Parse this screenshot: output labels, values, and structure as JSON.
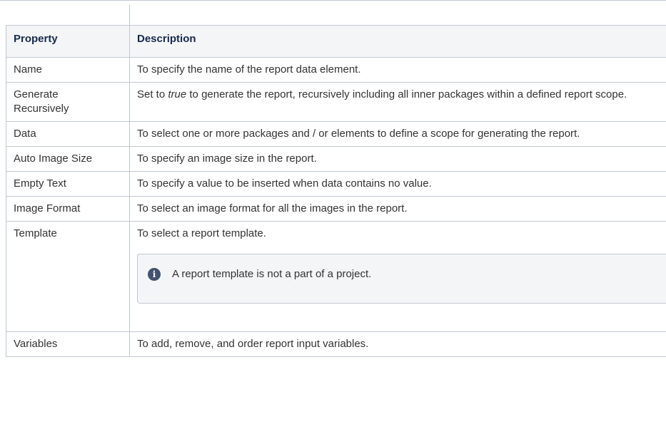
{
  "table": {
    "headers": {
      "property": "Property",
      "description": "Description"
    },
    "rows": [
      {
        "property": "Name",
        "description": "To specify the name of the report data element."
      },
      {
        "property": "Generate Recursively",
        "description_pre": "Set to ",
        "description_em": "true",
        "description_post": " to generate the report, recursively including all inner packages within a defined report scope."
      },
      {
        "property": "Data",
        "description": "To select one or more packages and / or elements to define a scope for generating the report."
      },
      {
        "property": "Auto Image Size",
        "description": "To specify an image size in the report."
      },
      {
        "property": "Empty Text",
        "description": "To specify a value to be inserted when data contains no value."
      },
      {
        "property": "Image Format",
        "description": "To select an image format for all the images in the report."
      },
      {
        "property": "Template",
        "description": "To select a report template.",
        "info": {
          "icon": "info-icon",
          "text": "A report template is not a part of a project."
        }
      },
      {
        "property": "Variables",
        "description": "To add, remove, and order report input variables."
      }
    ]
  }
}
